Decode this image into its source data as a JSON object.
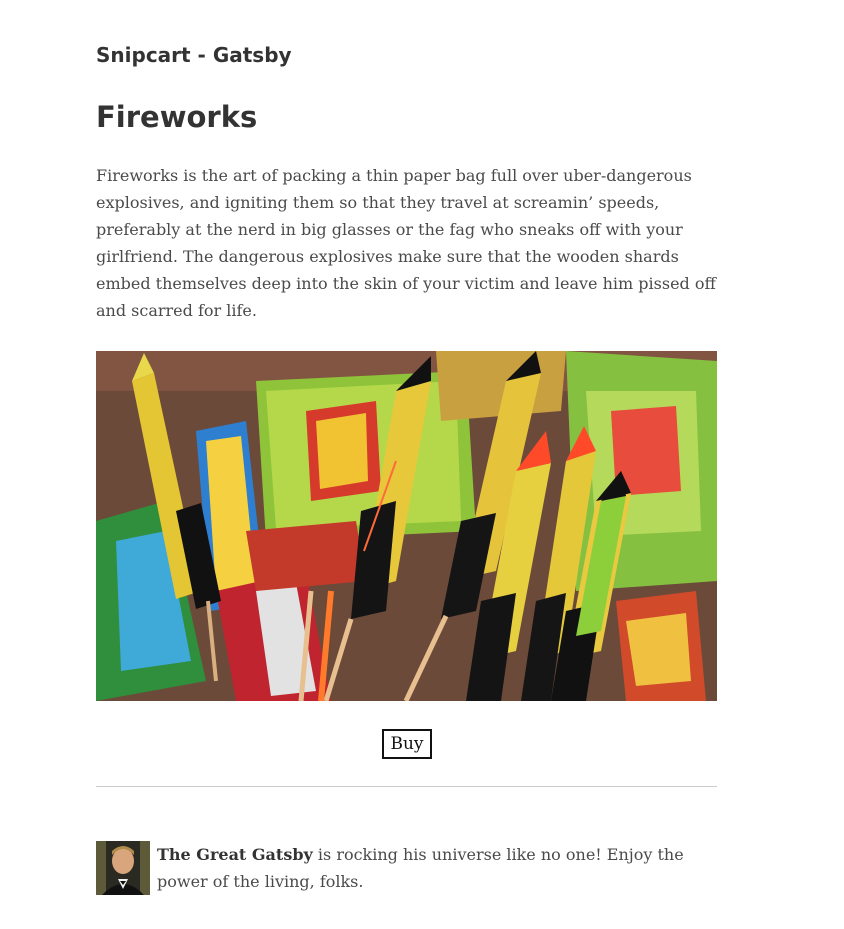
{
  "site": {
    "title": "Snipcart - Gatsby"
  },
  "product": {
    "title": "Fireworks",
    "description": "Fireworks is the art of packing a thin paper bag full over uber-dangerous explosives, and igniting them so that they travel at screamin’ speeds, preferably at the nerd in big glasses or the fag who sneaks off with your girlfriend. The dangerous explosives make sure that the wooden shards embed themselves deep into the skin of your victim and leave him pissed off and scarred for life.",
    "image_alt": "Fireworks",
    "buy_label": "Buy"
  },
  "bio": {
    "name": "The Great Gatsby",
    "text": " is rocking his universe like no one! Enjoy the power of the living, folks.",
    "avatar_alt": "The Great Gatsby"
  },
  "colors": {
    "text": "#333333",
    "body_text": "#4a4a4a",
    "divider": "#cccccc",
    "button_border": "#111111"
  }
}
